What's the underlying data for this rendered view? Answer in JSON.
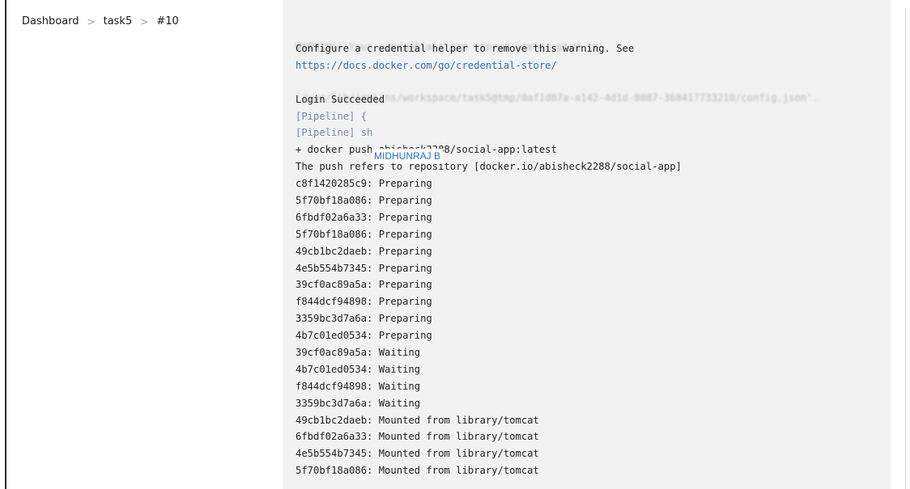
{
  "breadcrumb": {
    "items": [
      "Dashboard",
      "task5",
      "#10"
    ],
    "separator": ">"
  },
  "console": {
    "faded_lines": [
      "WARNING! Your credentials are stored unencrypted in",
      "'/var/lib/jenkins/workspace/task5@tmp/0af1d87a-a142-4d1d-8087-368417733210/config.json'."
    ],
    "lines": [
      {
        "text": "Configure a credential helper to remove this warning. See",
        "kind": "text"
      },
      {
        "text": "https://docs.docker.com/go/credential-store/",
        "kind": "link"
      },
      {
        "text": "",
        "kind": "text"
      },
      {
        "text": "Login Succeeded",
        "kind": "text"
      },
      {
        "text": "[Pipeline] {",
        "kind": "pipeline"
      },
      {
        "text": "[Pipeline] sh",
        "kind": "pipeline"
      },
      {
        "text": "+ docker push abisheck2288/social-app:latest",
        "kind": "text"
      },
      {
        "text": "The push refers to repository [docker.io/abisheck2288/social-app]",
        "kind": "text"
      },
      {
        "text": "c8f1420285c9: Preparing",
        "kind": "text"
      },
      {
        "text": "5f70bf18a086: Preparing",
        "kind": "text"
      },
      {
        "text": "6fbdf02a6a33: Preparing",
        "kind": "text"
      },
      {
        "text": "5f70bf18a086: Preparing",
        "kind": "text"
      },
      {
        "text": "49cb1bc2daeb: Preparing",
        "kind": "text"
      },
      {
        "text": "4e5b554b7345: Preparing",
        "kind": "text"
      },
      {
        "text": "39cf0ac89a5a: Preparing",
        "kind": "text"
      },
      {
        "text": "f844dcf94898: Preparing",
        "kind": "text"
      },
      {
        "text": "3359bc3d7a6a: Preparing",
        "kind": "text"
      },
      {
        "text": "4b7c01ed0534: Preparing",
        "kind": "text"
      },
      {
        "text": "39cf0ac89a5a: Waiting",
        "kind": "text"
      },
      {
        "text": "4b7c01ed0534: Waiting",
        "kind": "text"
      },
      {
        "text": "f844dcf94898: Waiting",
        "kind": "text"
      },
      {
        "text": "3359bc3d7a6a: Waiting",
        "kind": "text"
      },
      {
        "text": "49cb1bc2daeb: Mounted from library/tomcat",
        "kind": "text"
      },
      {
        "text": "6fbdf02a6a33: Mounted from library/tomcat",
        "kind": "text"
      },
      {
        "text": "4e5b554b7345: Mounted from library/tomcat",
        "kind": "text"
      },
      {
        "text": "5f70bf18a086: Mounted from library/tomcat",
        "kind": "text"
      }
    ]
  },
  "tooltip": {
    "text": "MIDHUNRAJ B"
  }
}
